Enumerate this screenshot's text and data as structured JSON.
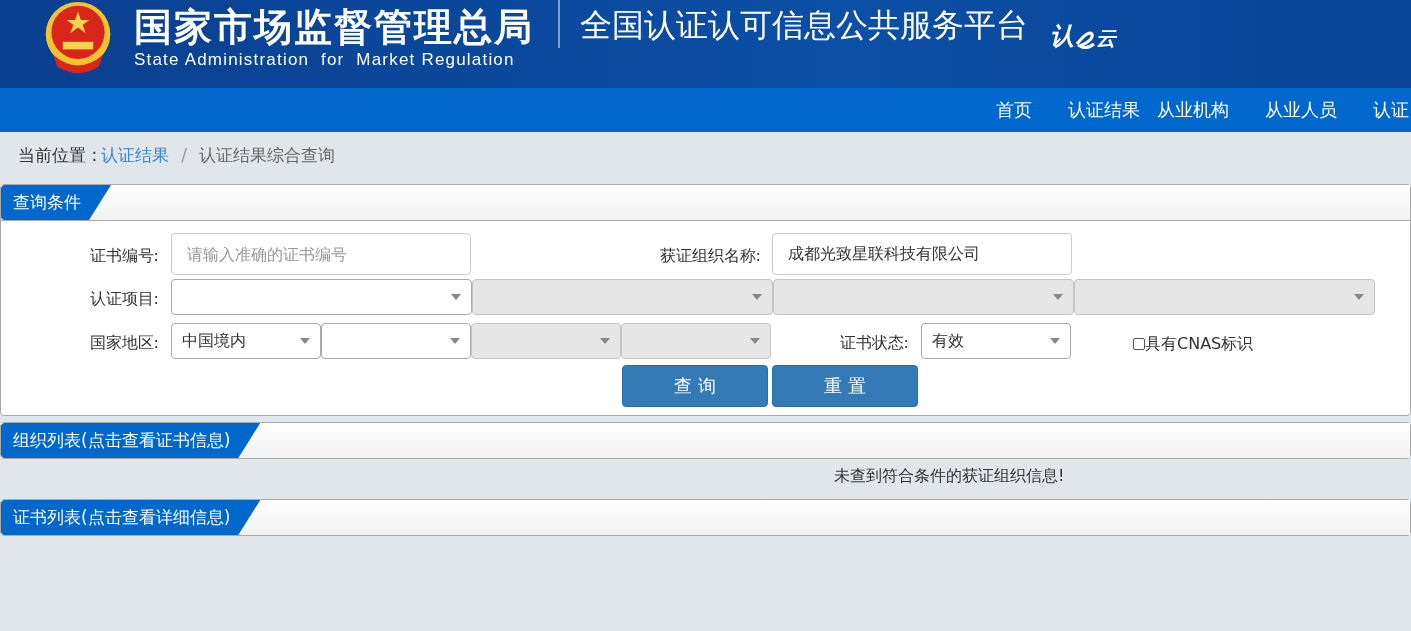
{
  "header": {
    "agency_cn": "国家市场监督管理总局",
    "agency_en": "State Administration  for  Market Regulation",
    "platform": "全国认证认可信息公共服务平台",
    "logo_chars": [
      "认",
      "云"
    ]
  },
  "nav": [
    "首页",
    "认证结果",
    "从业机构",
    "从业人员",
    "认证"
  ],
  "breadcrumb": {
    "label": "当前位置 :",
    "link": "认证结果",
    "separator": "/",
    "current": "认证结果综合查询"
  },
  "query_panel": {
    "title": "查询条件",
    "cert_number": {
      "label": "证书编号:",
      "placeholder": "请输入准确的证书编号"
    },
    "org_name": {
      "label": "获证组织名称:",
      "value": "成都光致星联科技有限公司"
    },
    "cert_project": {
      "label": "认证项目:",
      "selects": [
        {
          "disabled": false
        },
        {
          "disabled": true
        },
        {
          "disabled": true
        },
        {
          "disabled": true
        }
      ]
    },
    "region": {
      "label": "国家地区:",
      "selects": [
        {
          "value": "中国境内",
          "disabled": false
        },
        {
          "disabled": false
        },
        {
          "disabled": true
        },
        {
          "disabled": true
        }
      ]
    },
    "status": {
      "label": "证书状态:",
      "value": "有效"
    },
    "cnas": {
      "label": "具有CNAS标识",
      "checked": false
    },
    "buttons": [
      "查 询",
      "重 置"
    ]
  },
  "org_panel": {
    "title": "组织列表(点击查看证书信息)",
    "message": "未查到符合条件的获证组织信息!"
  },
  "cert_panel": {
    "title": "证书列表(点击查看详细信息)"
  }
}
